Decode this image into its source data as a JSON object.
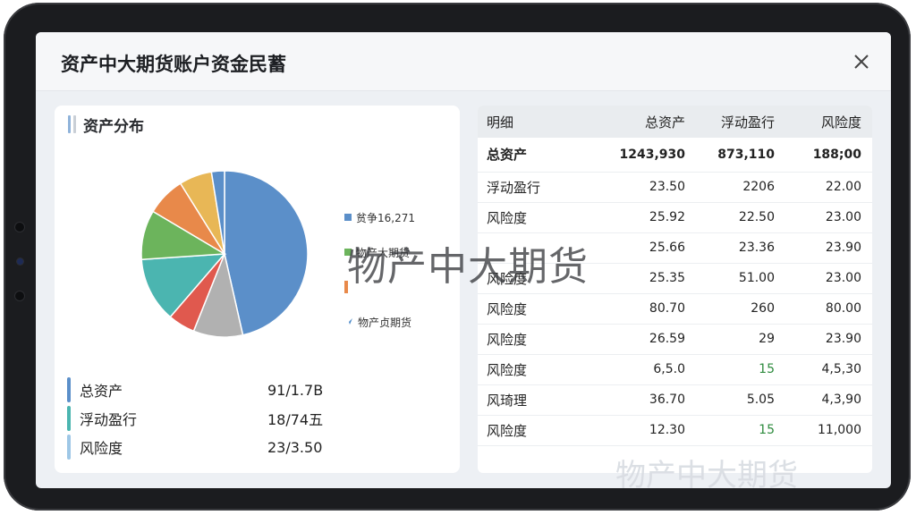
{
  "header": {
    "title": "资产中大期货账户资金民蓄"
  },
  "left": {
    "title": "资产分布",
    "legend": [
      {
        "label": "贫争16,271",
        "color": "#5b8fc9"
      },
      {
        "label": "物产大期货",
        "color": "#6cb45c"
      },
      {
        "label": "",
        "color": "#e8894a"
      },
      {
        "label": "物产贞期货",
        "color": "#4a88c8"
      }
    ],
    "summary": [
      {
        "label": "总资产",
        "value": "91/1.7B",
        "color": "#5b8fc9"
      },
      {
        "label": "浮动盈行",
        "value": "18/74五",
        "color": "#4bb5b0"
      },
      {
        "label": "风险度",
        "value": "23/3.50",
        "color": "#9ec7e6"
      }
    ]
  },
  "chart_data": {
    "type": "pie",
    "values": [
      46,
      9.5,
      5.2,
      12.5,
      9.5,
      7.5,
      6.3,
      2.5
    ],
    "colors": [
      "#5b8fc9",
      "#b1b1b1",
      "#e0594e",
      "#4bb5b0",
      "#6cb45c",
      "#e8894a",
      "#e8b756",
      "#5b8fc9"
    ]
  },
  "table": {
    "headers": [
      "明细",
      "总资产",
      "浮动盈行",
      "风险度"
    ],
    "rows": [
      [
        "总资产",
        "1243,930",
        "873,110",
        "188;00"
      ],
      [
        "浮动盈行",
        "23.50",
        "2206",
        "22.00"
      ],
      [
        "风险度",
        "25.92",
        "22.50",
        "23.00"
      ],
      [
        "",
        "25.66",
        "23.36",
        "23.90"
      ],
      [
        "风险度",
        "25.35",
        "51.00",
        "23.00"
      ],
      [
        "风险度",
        "80.70",
        "260",
        "80.00"
      ],
      [
        "风险度",
        "26.59",
        "29",
        "23.90"
      ],
      [
        "风险度",
        "6,5.0",
        "15",
        "4,5,30"
      ],
      [
        "风琦理",
        "36.70",
        "5.05",
        "4,3,90"
      ],
      [
        "风险度",
        "12.30",
        "15",
        "11,000"
      ]
    ],
    "positive_cells": [
      [
        7,
        2
      ],
      [
        9,
        2
      ]
    ]
  },
  "watermark": "物产中大期货",
  "watermark_faint": "物产中大期货"
}
